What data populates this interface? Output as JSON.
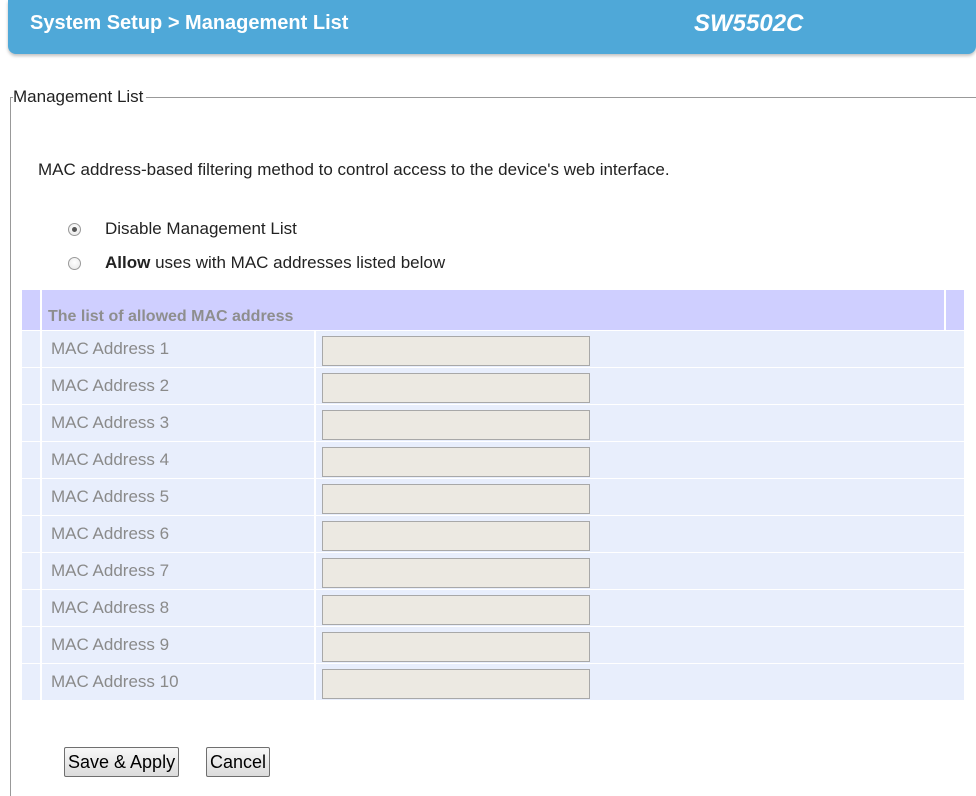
{
  "header": {
    "breadcrumb": "System Setup > Management List",
    "model": "SW5502C"
  },
  "section": {
    "legend": "Management List",
    "description": "MAC address-based filtering method to control access to the device's web interface."
  },
  "options": {
    "disable_label": "Disable Management List",
    "allow_bold": "Allow",
    "allow_rest": " uses with MAC addresses listed below",
    "selected": "disable"
  },
  "table": {
    "header": "The list of allowed MAC address",
    "rows": [
      {
        "label": "MAC Address 1",
        "value": ""
      },
      {
        "label": "MAC Address 2",
        "value": ""
      },
      {
        "label": "MAC Address 3",
        "value": ""
      },
      {
        "label": "MAC Address 4",
        "value": ""
      },
      {
        "label": "MAC Address 5",
        "value": ""
      },
      {
        "label": "MAC Address 6",
        "value": ""
      },
      {
        "label": "MAC Address 7",
        "value": ""
      },
      {
        "label": "MAC Address 8",
        "value": ""
      },
      {
        "label": "MAC Address 9",
        "value": ""
      },
      {
        "label": "MAC Address 10",
        "value": ""
      }
    ]
  },
  "buttons": {
    "save": "Save & Apply",
    "cancel": "Cancel"
  },
  "colors": {
    "header_bg": "#4fa8d8",
    "table_header_bg": "#cfcfff",
    "row_bg": "#e8eefc",
    "input_bg": "#ece9e2"
  }
}
